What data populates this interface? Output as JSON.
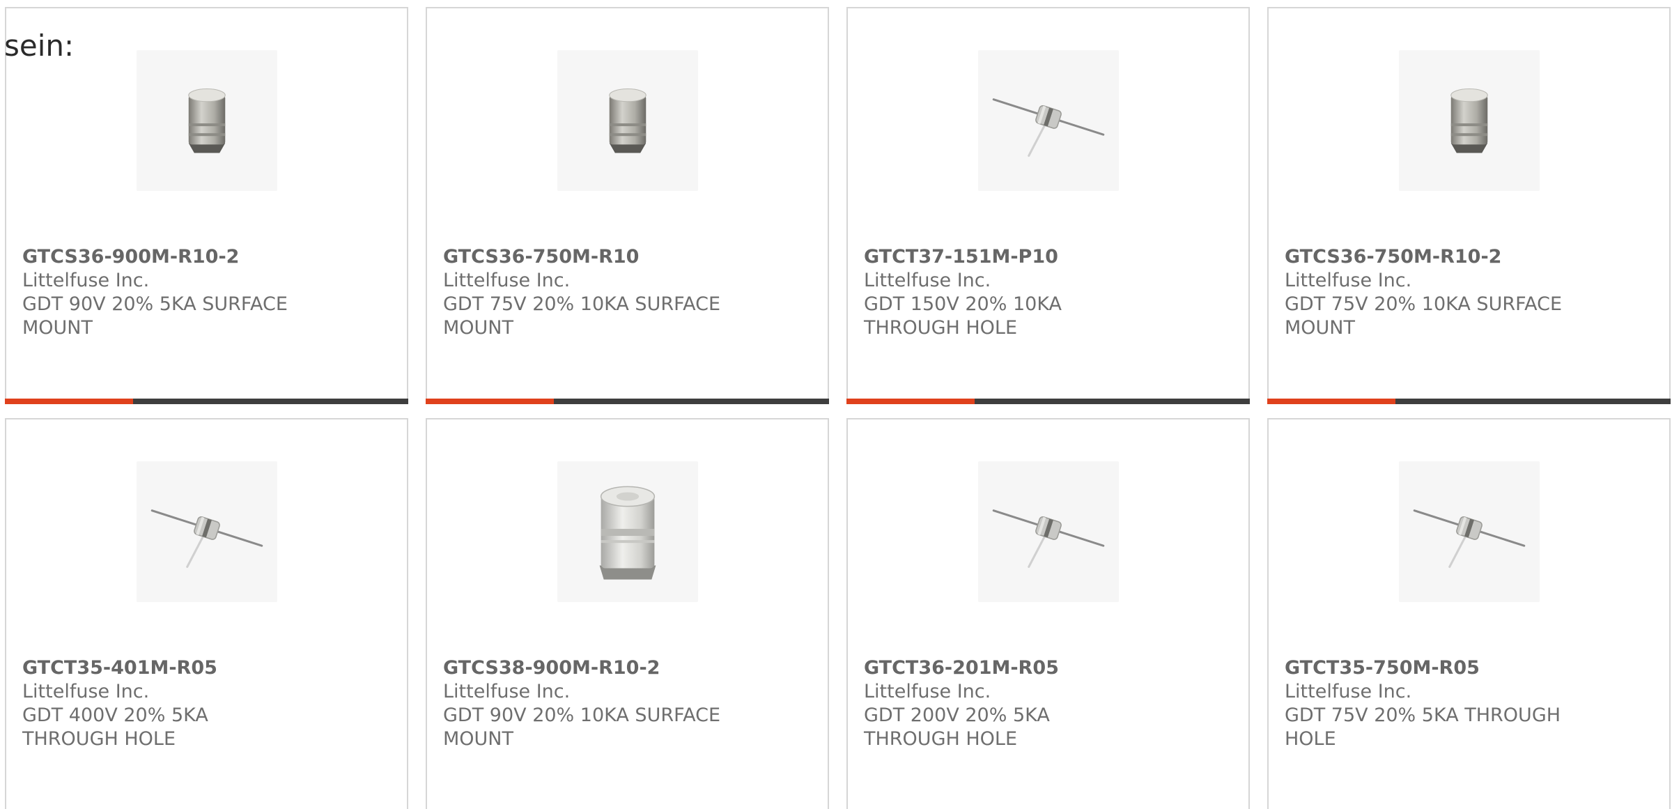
{
  "intro_text": "sein:",
  "colors": {
    "accent": "#e0411c",
    "bar": "#3e3e3e",
    "text": "#6e6e6e",
    "border": "#d6d6d6"
  },
  "products": [
    {
      "part_number": "GTCS36-900M-R10-2",
      "manufacturer": "Littelfuse Inc.",
      "description": "GDT 90V 20% 5KA SURFACE MOUNT",
      "image_icon": "surface-mount-gdt-icon"
    },
    {
      "part_number": "GTCS36-750M-R10",
      "manufacturer": "Littelfuse Inc.",
      "description": "GDT 75V 20% 10KA SURFACE MOUNT",
      "image_icon": "surface-mount-gdt-icon"
    },
    {
      "part_number": "GTCT37-151M-P10",
      "manufacturer": "Littelfuse Inc.",
      "description": "GDT 150V 20% 10KA THROUGH HOLE",
      "image_icon": "through-hole-gdt-icon"
    },
    {
      "part_number": "GTCS36-750M-R10-2",
      "manufacturer": "Littelfuse Inc.",
      "description": "GDT 75V 20% 10KA SURFACE MOUNT",
      "image_icon": "surface-mount-gdt-icon"
    },
    {
      "part_number": "GTCT35-401M-R05",
      "manufacturer": "Littelfuse Inc.",
      "description": "GDT 400V 20% 5KA THROUGH HOLE",
      "image_icon": "through-hole-gdt-icon"
    },
    {
      "part_number": "GTCS38-900M-R10-2",
      "manufacturer": "Littelfuse Inc.",
      "description": "GDT 90V 20% 10KA SURFACE MOUNT",
      "image_icon": "large-surface-mount-gdt-icon"
    },
    {
      "part_number": "GTCT36-201M-R05",
      "manufacturer": "Littelfuse Inc.",
      "description": "GDT 200V 20% 5KA THROUGH HOLE",
      "image_icon": "through-hole-gdt-icon"
    },
    {
      "part_number": "GTCT35-750M-R05",
      "manufacturer": "Littelfuse Inc.",
      "description": "GDT 75V 20% 5KA THROUGH HOLE",
      "image_icon": "through-hole-gdt-icon"
    }
  ]
}
